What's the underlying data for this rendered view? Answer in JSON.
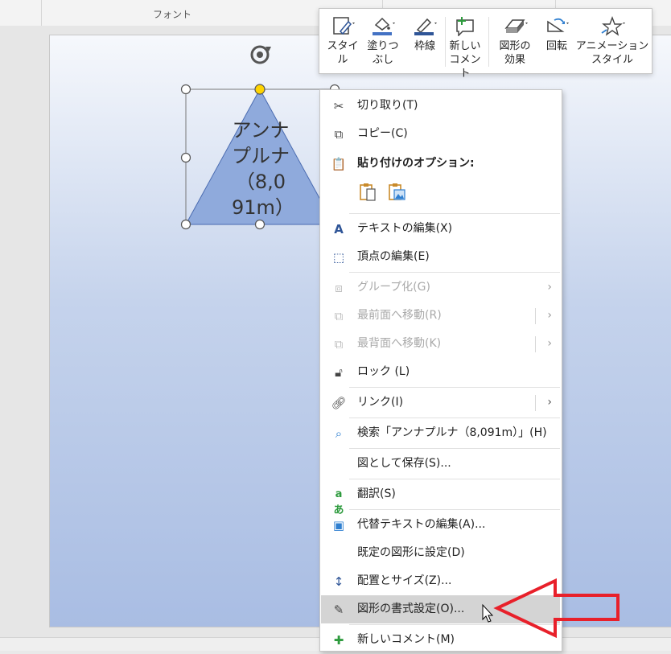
{
  "ribbon": {
    "group_label": "フォント"
  },
  "shape": {
    "text": "アンナプルナ（8,091m）"
  },
  "mini_toolbar": {
    "buttons": [
      {
        "label": "スタイル",
        "icon": "style-icon"
      },
      {
        "label": "塗りつぶし",
        "icon": "fill-bucket-icon"
      },
      {
        "label": "枠線",
        "icon": "outline-pen-icon"
      },
      {
        "label": "新しいコメント",
        "icon": "new-comment-icon"
      },
      {
        "label": "図形の効果",
        "icon": "shape-effects-icon"
      },
      {
        "label": "回転",
        "icon": "rotate-icon"
      },
      {
        "label": "アニメーションスタイル",
        "icon": "animation-star-icon"
      }
    ],
    "labels_split": {
      "style": "スタイル",
      "fill_1": "塗りつ",
      "fill_2": "ぶし",
      "outline": "枠線",
      "comment_1": "新しい",
      "comment_2": "コメント",
      "effects_1": "図形の",
      "effects_2": "効果",
      "rotate": "回転",
      "anim_1": "アニメーション",
      "anim_2": "スタイル"
    },
    "colors": {
      "fill_bar": "#4472c4",
      "outline_bar": "#2f5597",
      "comment_plus": "#2e9b3e"
    }
  },
  "context_menu": {
    "cut": "切り取り(T)",
    "copy": "コピー(C)",
    "paste_options": "貼り付けのオプション:",
    "edit_text": "テキストの編集(X)",
    "edit_points": "頂点の編集(E)",
    "group": "グループ化(G)",
    "bring_front": "最前面へ移動(R)",
    "send_back": "最背面へ移動(K)",
    "lock": "ロック (L)",
    "link": "リンク(I)",
    "search": "検索「アンナプルナ（8,091m）」(H)",
    "save_as_picture": "図として保存(S)...",
    "translate": "翻訳(S)",
    "edit_alt_text": "代替テキストの編集(A)...",
    "set_default_shape": "既定の図形に設定(D)",
    "size_position": "配置とサイズ(Z)...",
    "format_shape": "図形の書式設定(O)...",
    "new_comment": "新しいコメント(M)"
  },
  "colors": {
    "shape_fill": "#8faadc",
    "shape_stroke": "#4a6bb0",
    "handle_yellow": "#ffd400",
    "annotation_arrow": "#e8202a",
    "menu_highlight": "#d4d4d4"
  }
}
